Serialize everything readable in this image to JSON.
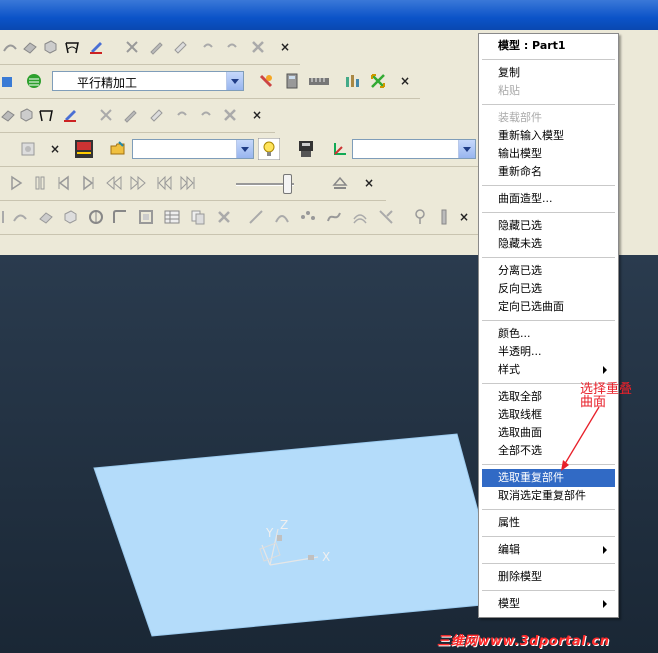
{
  "toolbar": {
    "nc_operation_value": "平行精加工",
    "close_label": "×"
  },
  "context_menu": {
    "header": "模型 : Part1",
    "items": [
      {
        "label": "复制",
        "enabled": true
      },
      {
        "label": "粘贴",
        "enabled": false
      },
      {
        "label": "装载部件",
        "enabled": false
      },
      {
        "label": "重新输入模型",
        "enabled": true
      },
      {
        "label": "输出模型",
        "enabled": true
      },
      {
        "label": "重新命名",
        "enabled": true
      },
      {
        "label": "曲面造型...",
        "enabled": true
      },
      {
        "label": "隐藏已选",
        "enabled": true
      },
      {
        "label": "隐藏未选",
        "enabled": true
      },
      {
        "label": "分离已选",
        "enabled": true
      },
      {
        "label": "反向已选",
        "enabled": true
      },
      {
        "label": "定向已选曲面",
        "enabled": true
      },
      {
        "label": "颜色...",
        "enabled": true
      },
      {
        "label": "半透明...",
        "enabled": true
      },
      {
        "label": "样式",
        "enabled": true,
        "submenu": true
      },
      {
        "label": "选取全部",
        "enabled": true
      },
      {
        "label": "选取线框",
        "enabled": true
      },
      {
        "label": "选取曲面",
        "enabled": true
      },
      {
        "label": "全部不选",
        "enabled": true
      },
      {
        "label": "选取重复部件",
        "enabled": true,
        "selected": true
      },
      {
        "label": "取消选定重复部件",
        "enabled": true
      },
      {
        "label": "属性",
        "enabled": true
      },
      {
        "label": "编辑",
        "enabled": true,
        "submenu": true
      },
      {
        "label": "删除模型",
        "enabled": true
      },
      {
        "label": "模型",
        "enabled": true,
        "submenu": true
      }
    ]
  },
  "annotation": {
    "line1": "选择重叠",
    "line2": "曲面",
    "color": "#e8202a"
  },
  "axis": {
    "x": "X",
    "y": "Y",
    "z": "Z"
  },
  "watermark": "三维网www.3dportal.cn",
  "colors": {
    "surface": "#b4dcfa",
    "menu_highlight": "#316ac5",
    "titlebar": "#0b53c8",
    "background": "#1c2a3a"
  }
}
